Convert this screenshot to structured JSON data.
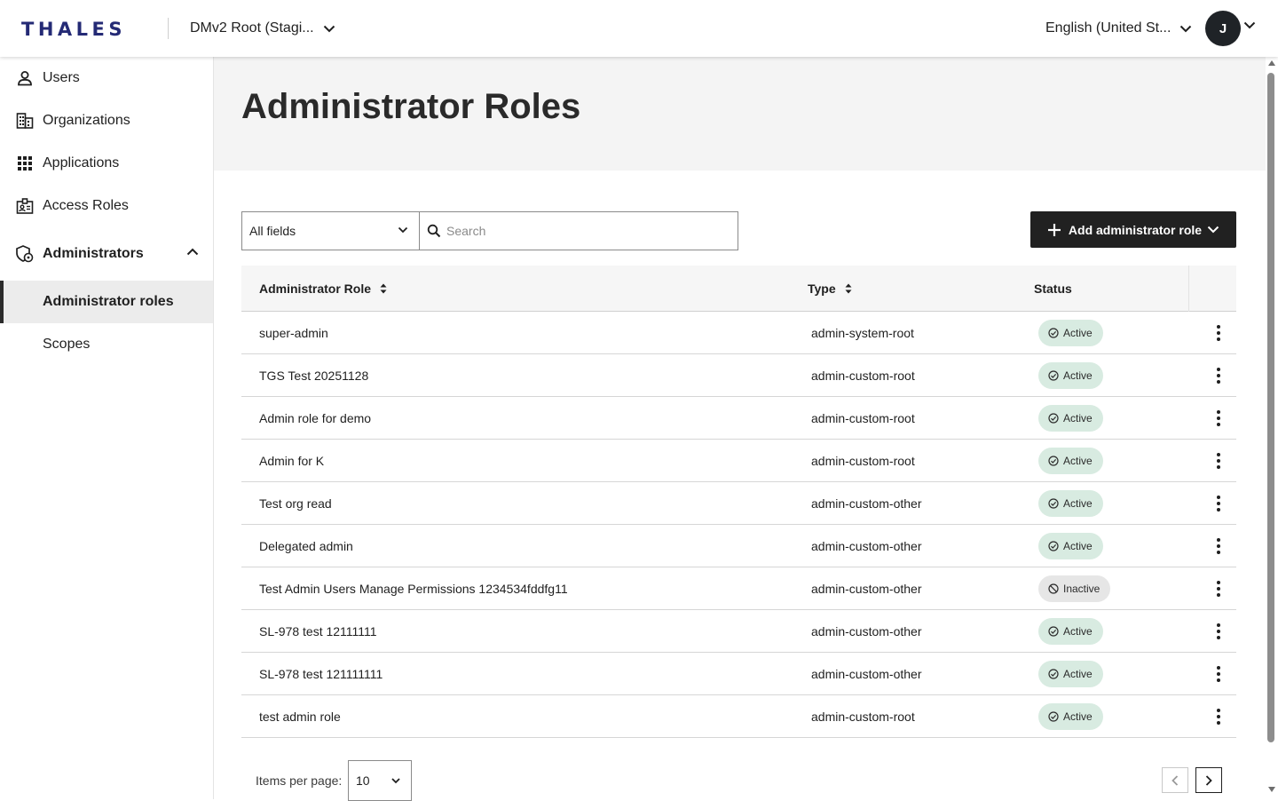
{
  "header": {
    "logo": "THALES",
    "tenant": "DMv2 Root (Stagi...",
    "language": "English (United St...",
    "avatar_initial": "J"
  },
  "sidebar": {
    "items": [
      {
        "label": "Users",
        "icon": "user-icon"
      },
      {
        "label": "Organizations",
        "icon": "building-icon"
      },
      {
        "label": "Applications",
        "icon": "apps-grid-icon"
      },
      {
        "label": "Access Roles",
        "icon": "badge-icon"
      },
      {
        "label": "Administrators",
        "icon": "admin-shield-icon",
        "expanded": true
      }
    ],
    "sub_items": [
      {
        "label": "Administrator roles",
        "active": true
      },
      {
        "label": "Scopes",
        "active": false
      }
    ]
  },
  "main": {
    "title": "Administrator Roles",
    "filter": {
      "selected": "All fields"
    },
    "search": {
      "placeholder": "Search",
      "value": ""
    },
    "add_button": "Add administrator role",
    "table": {
      "columns": [
        "Administrator Role",
        "Type",
        "Status"
      ],
      "rows": [
        {
          "role": "super-admin",
          "type": "admin-system-root",
          "status": "Active"
        },
        {
          "role": "TGS Test 20251128",
          "type": "admin-custom-root",
          "status": "Active"
        },
        {
          "role": "Admin role for demo",
          "type": "admin-custom-root",
          "status": "Active"
        },
        {
          "role": "Admin for K",
          "type": "admin-custom-root",
          "status": "Active"
        },
        {
          "role": "Test org read",
          "type": "admin-custom-other",
          "status": "Active"
        },
        {
          "role": "Delegated admin",
          "type": "admin-custom-other",
          "status": "Active"
        },
        {
          "role": "Test Admin Users Manage Permissions 1234534fddfg11",
          "type": "admin-custom-other",
          "status": "Inactive"
        },
        {
          "role": "SL-978 test 12111111",
          "type": "admin-custom-other",
          "status": "Active"
        },
        {
          "role": "SL-978 test 121111111",
          "type": "admin-custom-other",
          "status": "Active"
        },
        {
          "role": "test admin role",
          "type": "admin-custom-root",
          "status": "Active"
        }
      ]
    },
    "pagination": {
      "items_per_page_label": "Items per page:",
      "items_per_page": "10"
    }
  },
  "colors": {
    "brand": "#242a75",
    "active_badge": "#d8ebe1",
    "inactive_badge": "#e6e6e6",
    "primary_button": "#212121"
  }
}
